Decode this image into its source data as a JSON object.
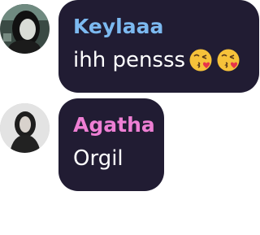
{
  "messages": [
    {
      "sender": "Keylaaa",
      "sender_color": "#7cb9f0",
      "text": "ihh pensss",
      "emojis": [
        "face-blowing-kiss-icon",
        "face-blowing-kiss-icon"
      ]
    },
    {
      "sender": "Agatha",
      "sender_color": "#ee7fd4",
      "text": "Orgil",
      "emojis": []
    }
  ],
  "theme": {
    "bubble_color": "#211c33",
    "text_color": "#ffffff",
    "background": "#ffffff"
  }
}
